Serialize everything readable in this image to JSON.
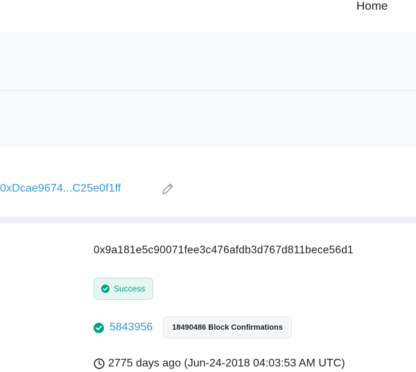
{
  "nav": {
    "home_label": "Home"
  },
  "address": {
    "label": "0xDcae9674...C25e0f1ff",
    "edit_icon": "pencil-icon"
  },
  "transaction": {
    "hash": "0x9a181e5c90071fee3c476afdb3d767d811bece56d1",
    "status": "Success",
    "block_number": "5843956",
    "confirmations": "18490486 Block Confirmations",
    "timestamp": "2775 days ago (Jun-24-2018 04:03:53 AM UTC)"
  },
  "colors": {
    "link": "#3498db",
    "success": "#00a186",
    "text": "#1e2022"
  }
}
